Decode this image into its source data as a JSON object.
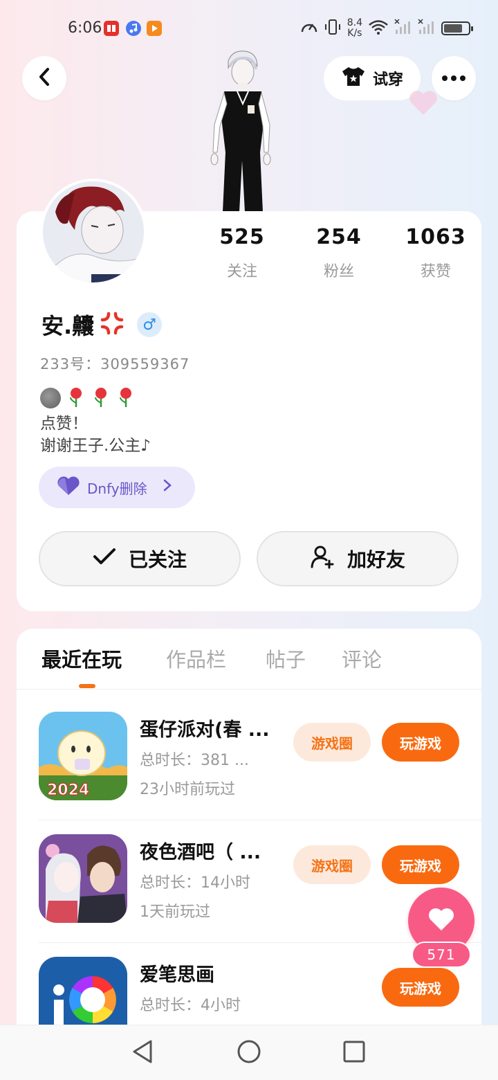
{
  "status_bar": {
    "time": "6:06",
    "net_speed_value": "8.4",
    "net_speed_unit": "K/s",
    "battery_level": 0.75
  },
  "header": {
    "try_on_label": "试穿"
  },
  "profile": {
    "stats": [
      {
        "value": "525",
        "label": "关注"
      },
      {
        "value": "254",
        "label": "粉丝"
      },
      {
        "value": "1063",
        "label": "获赞"
      }
    ],
    "username": "安.齉",
    "gender_symbol": "♂",
    "user_id": "233号：309559367",
    "bio_line1": "点赞！",
    "bio_line2": "谢谢王子.公主♪",
    "group_chip_label": "Dnfy删除",
    "follow_label": "已关注",
    "add_friend_label": "加好友"
  },
  "tabs": [
    {
      "label": "最近在玩",
      "active": true
    },
    {
      "label": "作品栏",
      "active": false
    },
    {
      "label": "帖子",
      "active": false
    },
    {
      "label": "评论",
      "active": false
    }
  ],
  "games": [
    {
      "title": "蛋仔派对(春 ...",
      "duration": "总时长：381 ...",
      "last_played": "23小时前玩过",
      "circle_label": "游戏圈",
      "play_label": "玩游戏",
      "icon_text": "2024"
    },
    {
      "title": "夜色酒吧（ ...",
      "duration": "总时长：14小时",
      "last_played": "1天前玩过",
      "circle_label": "游戏圈",
      "play_label": "玩游戏"
    },
    {
      "title": "爱笔思画",
      "duration": "总时长：4小时",
      "last_played": "",
      "play_label": "玩游戏"
    }
  ],
  "floating_like": {
    "count": "571"
  },
  "colors": {
    "accent_orange": "#f96a10",
    "like_pink": "#f85a86",
    "chip_purple": "#6a55c9"
  }
}
